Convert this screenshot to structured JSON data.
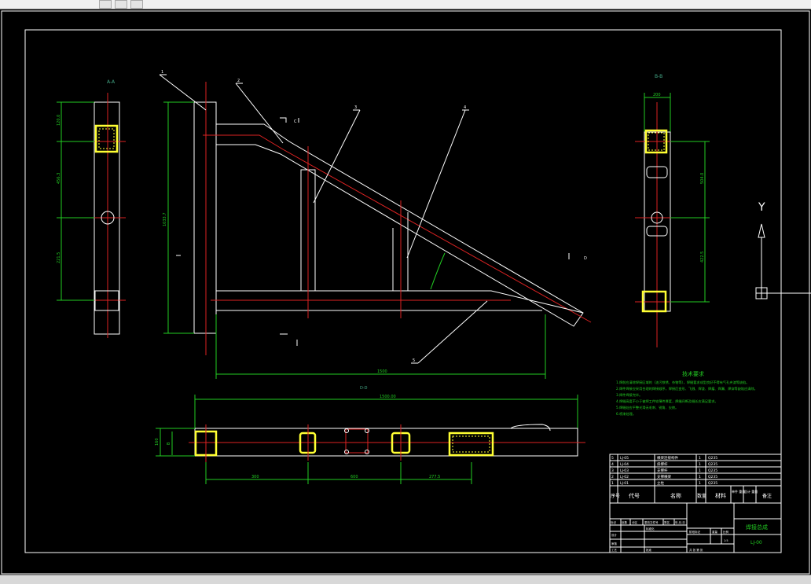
{
  "app": {
    "window": "CAD drawing viewer"
  },
  "drawing": {
    "part_numbers": [
      "1",
      "2",
      "3",
      "4",
      "5"
    ],
    "view_labels": {
      "left": "A-A",
      "right": "B-B",
      "bottom": "D-D",
      "section_c": "C",
      "section_d": "D"
    },
    "dimensions": {
      "left_top": "120.0",
      "left_mid": "456.3",
      "left_low": "221.5",
      "main_height": "1033.7",
      "main_width": "1500",
      "right_width": "200",
      "right_mid": "504.0",
      "right_low": "422.5",
      "bottom_total": "1500.00",
      "bottom_height": "160",
      "bottom_a": "300",
      "bottom_b": "600",
      "bottom_c": "277.5",
      "bottom_small": "B"
    },
    "ucs": {
      "y_label": "Y"
    }
  },
  "tech_requirements": {
    "title": "技术要求",
    "lines": [
      "1.焊前应清除焊接区域的（油污铁锈、杂物等），焊缝要求成型良好不得有气孔夹渣等缺陷。",
      "2.焊件焊接应采用合理的焊接顺序，焊接后变形、飞溅、焊渣、焊瘤、焊漏、焊穿等缺陷应清除。",
      "3.焊件焊接完毕。",
      "4.焊缝高度不小于被焊工件较薄件厚度，焊缝间断及缝长应满足要求。",
      "5.焊缝处应平整光滑无毛刺、锐角、尖棱。",
      "6.喷漆处理。"
    ]
  },
  "title_block": {
    "parts": [
      {
        "no": "5",
        "code": "LJ-05",
        "name": "横梁连接构件",
        "qty": "1",
        "material": "Q235"
      },
      {
        "no": "4",
        "code": "LJ-04",
        "name": "斜撑杆",
        "qty": "1",
        "material": "Q235"
      },
      {
        "no": "3",
        "code": "LJ-03",
        "name": "支撑杆",
        "qty": "1",
        "material": "Q235"
      },
      {
        "no": "2",
        "code": "LJ-02",
        "name": "支撑横梁",
        "qty": "1",
        "material": "Q235"
      },
      {
        "no": "1",
        "code": "LJ-01",
        "name": "立柱",
        "qty": "1",
        "material": "Q235"
      }
    ],
    "header": {
      "no": "序号",
      "code": "代号",
      "name": "名称",
      "qty": "数量",
      "material": "材料",
      "weight": "单件 重量",
      "total": "总计 重量",
      "note": "备注"
    },
    "drawing_title": "焊接总成",
    "drawing_no": "LJ-00",
    "sign_row": [
      "标记",
      "处数",
      "分区",
      "更改文件号",
      "签名",
      "年.月.日"
    ],
    "stage_label": "阶段标记",
    "weight_label": "重量",
    "scale_label": "比例",
    "scale_value": "1:5",
    "left_labels": [
      "设计",
      "审核",
      "工艺"
    ],
    "standard_label": "标准化",
    "approve_label": "批准",
    "sheet_row": "共  张  第  张"
  }
}
